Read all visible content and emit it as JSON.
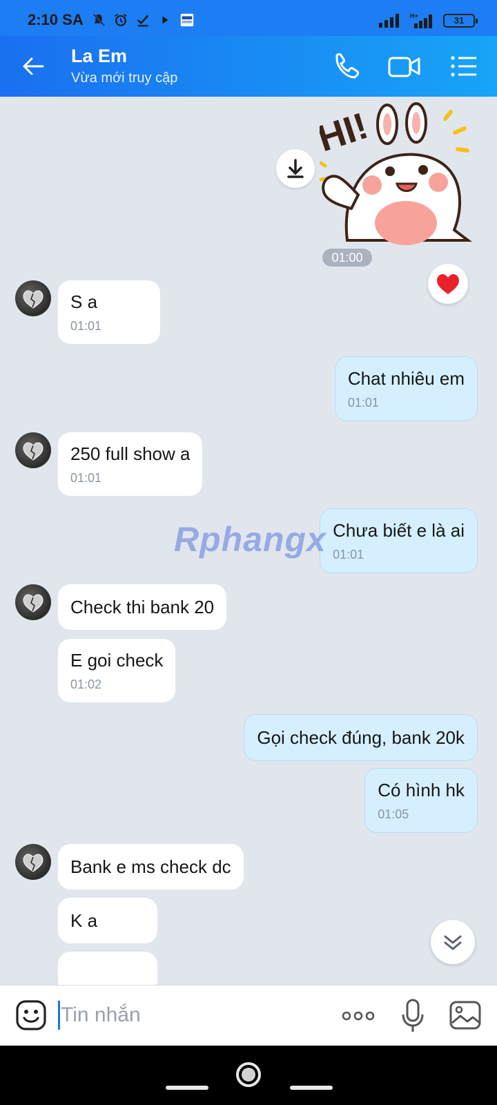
{
  "status_bar": {
    "time": "2:10 SA",
    "battery": "31",
    "icons": [
      "mute-icon",
      "alarm-icon",
      "check-icon",
      "play-icon",
      "acb-app-icon",
      "signal-icon",
      "h-plus-signal-icon",
      "battery-icon"
    ]
  },
  "header": {
    "title": "La Em",
    "subtitle": "Vừa mới truy cập",
    "icons": [
      "back-arrow-icon",
      "phone-icon",
      "video-camera-icon",
      "list-menu-icon"
    ]
  },
  "chat": {
    "sticker": {
      "text": "HI!",
      "time": "01:00"
    },
    "messages": [
      {
        "dir": "in",
        "text": "S a",
        "time": "01:01"
      },
      {
        "dir": "out",
        "text": "Chat nhiêu em",
        "time": "01:01"
      },
      {
        "dir": "in",
        "text": "250 full show a",
        "time": "01:01"
      },
      {
        "dir": "out",
        "text": "Chưa biết e là ai",
        "time": "01:01"
      },
      {
        "dir": "in",
        "text": "Check thi bank 20",
        "time": ""
      },
      {
        "dir": "in",
        "text": "E goi check",
        "time": "01:02"
      },
      {
        "dir": "out",
        "text": "Gọi check đúng, bank 20k",
        "time": ""
      },
      {
        "dir": "out",
        "text": "Có hình hk",
        "time": "01:05"
      },
      {
        "dir": "in",
        "text": "Bank e ms check dc",
        "time": ""
      },
      {
        "dir": "in",
        "text": "K a",
        "time": ""
      }
    ],
    "watermark": "Rphangx"
  },
  "input_bar": {
    "placeholder": "Tin nhắn",
    "icons": [
      "emoji-icon",
      "more-dots-icon",
      "microphone-icon",
      "image-icon"
    ]
  },
  "colors": {
    "header_start": "#1a6ff0",
    "header_end": "#18a4f7",
    "chat_bg": "#e1e6ed",
    "outgoing_bubble": "#d5efff",
    "incoming_bubble": "#ffffff"
  }
}
